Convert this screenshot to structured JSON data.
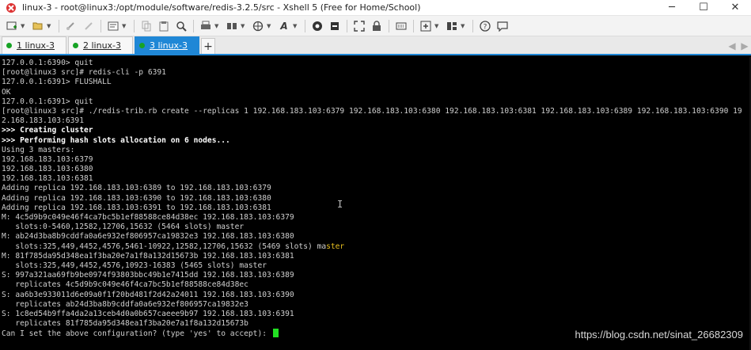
{
  "window": {
    "title": "linux-3 - root@linux3:/opt/module/software/redis-3.2.5/src - Xshell 5 (Free for Home/School)",
    "controls": {
      "minimize": "─",
      "maximize": "☐",
      "close": "✕"
    }
  },
  "toolbar": {
    "icons": [
      "new-session-icon",
      "open-folder-icon",
      "link-icon",
      "unlink-icon",
      "properties-icon",
      "copy-icon",
      "paste-icon",
      "find-icon",
      "print-icon",
      "transfer-icon",
      "globe-icon",
      "font-icon",
      "xftp-icon",
      "xmanager-icon",
      "fullscreen-icon",
      "lock-icon",
      "keyboard-icon",
      "add-icon",
      "layout-icon",
      "help-icon",
      "chat-icon"
    ]
  },
  "tabs": [
    {
      "label": "1 linux-3",
      "active": false
    },
    {
      "label": "2 linux-3",
      "active": false
    },
    {
      "label": "3 linux-3",
      "active": true
    }
  ],
  "tab_add": "+",
  "tab_nav": {
    "prev": "◀",
    "next": "▶"
  },
  "terminal": {
    "lines": [
      "127.0.0.1:6390> quit",
      "[root@linux3 src]# redis-cli -p 6391",
      "127.0.0.1:6391> FLUSHALL",
      "OK",
      "127.0.0.1:6391> quit",
      "[root@linux3 src]# ./redis-trib.rb create --replicas 1 192.168.183.103:6379 192.168.183.103:6380 192.168.183.103:6381 192.168.183.103:6389 192.168.183.103:6390 19",
      "2.168.183.103:6391",
      ">>> Creating cluster",
      ">>> Performing hash slots allocation on 6 nodes...",
      "Using 3 masters:",
      "192.168.183.103:6379",
      "192.168.183.103:6380",
      "192.168.183.103:6381",
      "Adding replica 192.168.183.103:6389 to 192.168.183.103:6379",
      "Adding replica 192.168.183.103:6390 to 192.168.183.103:6380",
      "Adding replica 192.168.183.103:6391 to 192.168.183.103:6381",
      "M: 4c5d9b9c049e46f4ca7bc5b1ef88588ce84d38ec 192.168.183.103:6379",
      "   slots:0-5460,12582,12706,15632 (5464 slots) master",
      "M: ab24d3ba8b9cddfa0a6e932ef806957ca19832e3 192.168.183.103:6380",
      "   slots:325,449,4452,4576,5461-10922,12582,12706,15632 (5469 slots) ma",
      "M: 81f785da95d348ea1f3ba20e7a1f8a132d15673b 192.168.183.103:6381",
      "   slots:325,449,4452,4576,10923-16383 (5465 slots) master",
      "S: 997a321aa69fb9be0974f93803bbc49b1e7415dd 192.168.183.103:6389",
      "   replicates 4c5d9b9c049e46f4ca7bc5b1ef88588ce84d38ec",
      "S: aa6b3e933011d6e09a0f1f20bd481f2d42a24011 192.168.183.103:6390",
      "   replicates ab24d3ba8b9cddfa0a6e932ef806957ca19832e3",
      "S: 1c8ed54b9ffa4da2a13ceb4d0a0b657caeee9b97 192.168.183.103:6391",
      "   replicates 81f785da95d348ea1f3ba20e7a1f8a132d15673b",
      "Can I set the above configuration? (type 'yes' to accept): "
    ],
    "highlight_suffix": "ster",
    "bold_lines": [
      7,
      8
    ]
  },
  "watermark": "https://blog.csdn.net/sinat_26682309",
  "colors": {
    "accent": "#1f87d6",
    "terminal_bg": "#000000",
    "cursor": "#22e022",
    "highlight": "#e8c020"
  }
}
